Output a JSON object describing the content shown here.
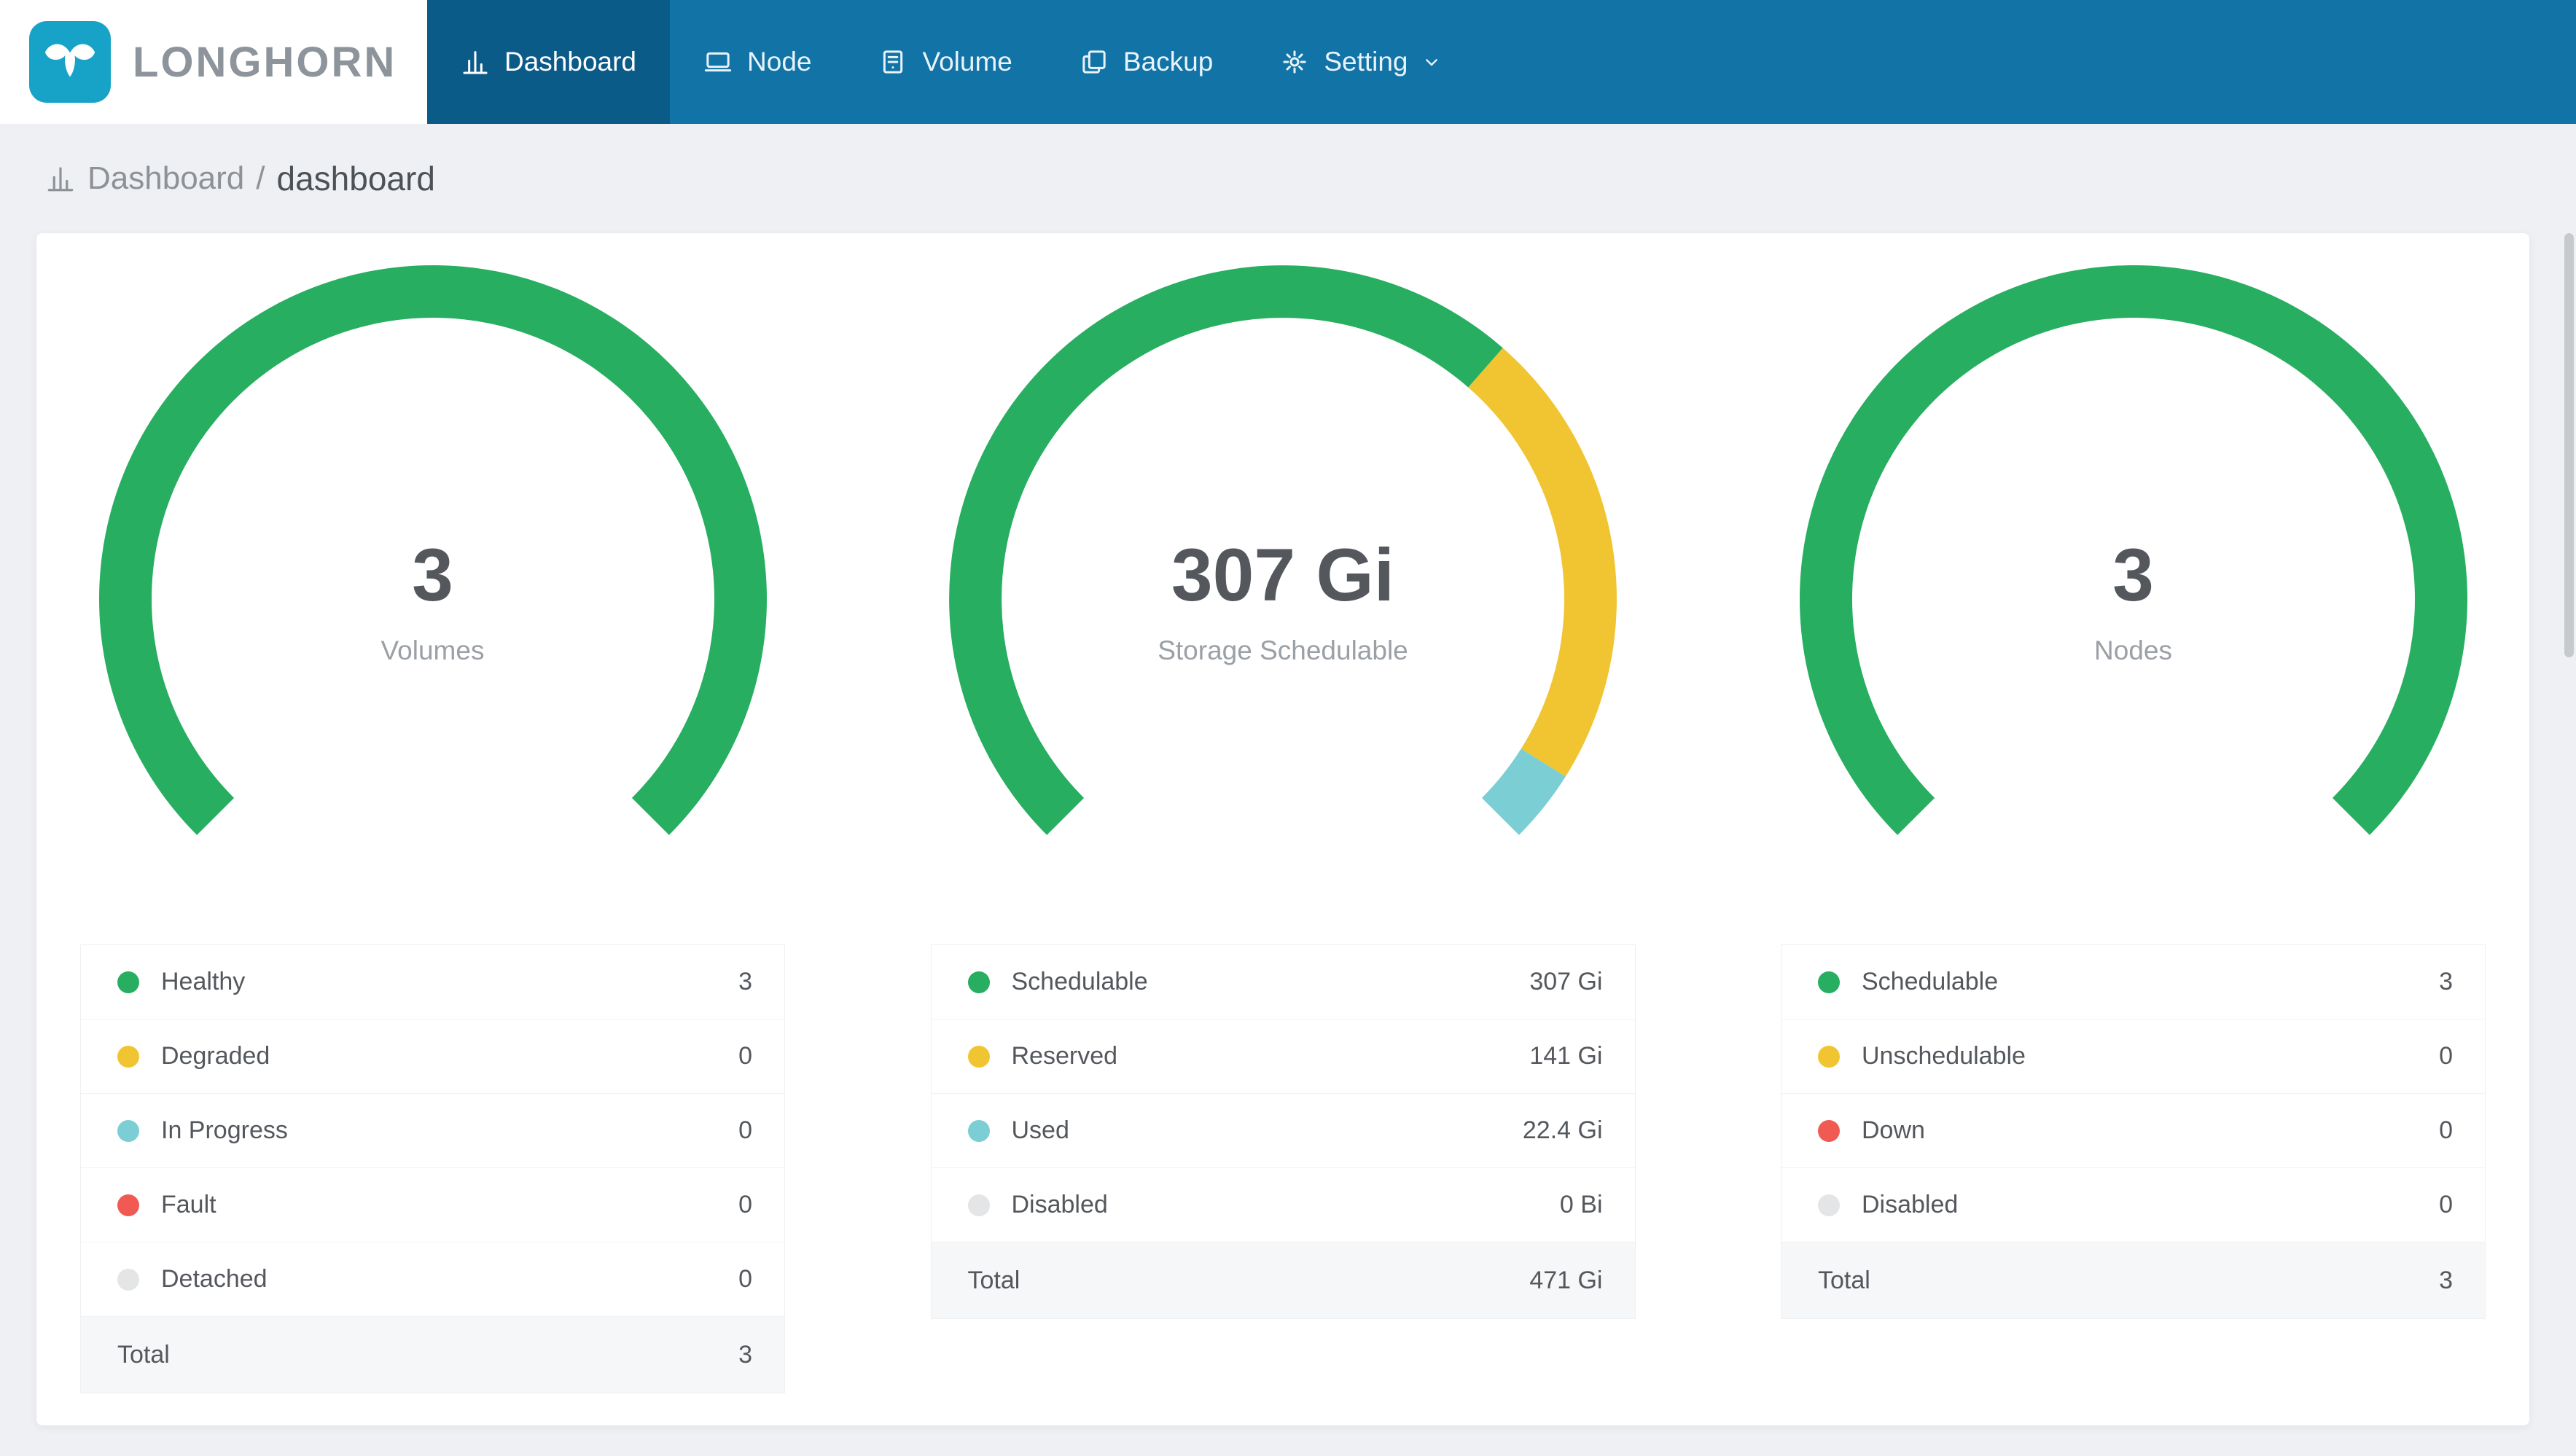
{
  "app": {
    "logo_text": "LONGHORN",
    "colors": {
      "navbar": "#1173a6",
      "navbar_active": "#0b5b89",
      "logo": "#17a3c7",
      "page_bg": "#eef0f3",
      "green": "#27ae60",
      "yellow": "#f1c531",
      "teal": "#7bced3",
      "red": "#f15a52",
      "gray_dot": "#e3e5e7"
    }
  },
  "nav": {
    "items": [
      {
        "label": "Dashboard",
        "icon": "bar-chart-icon",
        "active": true
      },
      {
        "label": "Node",
        "icon": "node-icon",
        "active": false
      },
      {
        "label": "Volume",
        "icon": "volume-icon",
        "active": false
      },
      {
        "label": "Backup",
        "icon": "backup-icon",
        "active": false
      },
      {
        "label": "Setting",
        "icon": "gear-icon",
        "active": false,
        "has_dropdown": true
      }
    ]
  },
  "breadcrumb": {
    "section": "Dashboard",
    "separator": "/",
    "page": "dashboard"
  },
  "chart_data": [
    {
      "type": "gauge",
      "title": "Volumes",
      "center_value": "3",
      "center_label": "Volumes",
      "sweep_deg": 270,
      "start_deg": -135,
      "segments": [
        {
          "label": "Healthy",
          "value": 3,
          "text": "3",
          "color": "#27ae60"
        },
        {
          "label": "Degraded",
          "value": 0,
          "text": "0",
          "color": "#f1c531"
        },
        {
          "label": "In Progress",
          "value": 0,
          "text": "0",
          "color": "#7bced3"
        },
        {
          "label": "Fault",
          "value": 0,
          "text": "0",
          "color": "#f15a52"
        },
        {
          "label": "Detached",
          "value": 0,
          "text": "0",
          "color": "#e3e5e7"
        }
      ],
      "total": {
        "label": "Total",
        "text": "3"
      }
    },
    {
      "type": "gauge",
      "title": "Storage Schedulable",
      "center_value": "307 Gi",
      "center_label": "Storage Schedulable",
      "sweep_deg": 270,
      "start_deg": -135,
      "segments": [
        {
          "label": "Schedulable",
          "value": 307,
          "text": "307 Gi",
          "color": "#27ae60"
        },
        {
          "label": "Reserved",
          "value": 141,
          "text": "141 Gi",
          "color": "#f1c531"
        },
        {
          "label": "Used",
          "value": 22.4,
          "text": "22.4 Gi",
          "color": "#7bced3"
        },
        {
          "label": "Disabled",
          "value": 0,
          "text": "0 Bi",
          "color": "#e3e5e7"
        }
      ],
      "total": {
        "label": "Total",
        "text": "471 Gi"
      }
    },
    {
      "type": "gauge",
      "title": "Nodes",
      "center_value": "3",
      "center_label": "Nodes",
      "sweep_deg": 270,
      "start_deg": -135,
      "segments": [
        {
          "label": "Schedulable",
          "value": 3,
          "text": "3",
          "color": "#27ae60"
        },
        {
          "label": "Unschedulable",
          "value": 0,
          "text": "0",
          "color": "#f1c531"
        },
        {
          "label": "Down",
          "value": 0,
          "text": "0",
          "color": "#f15a52"
        },
        {
          "label": "Disabled",
          "value": 0,
          "text": "0",
          "color": "#e3e5e7"
        }
      ],
      "total": {
        "label": "Total",
        "text": "3"
      }
    }
  ]
}
